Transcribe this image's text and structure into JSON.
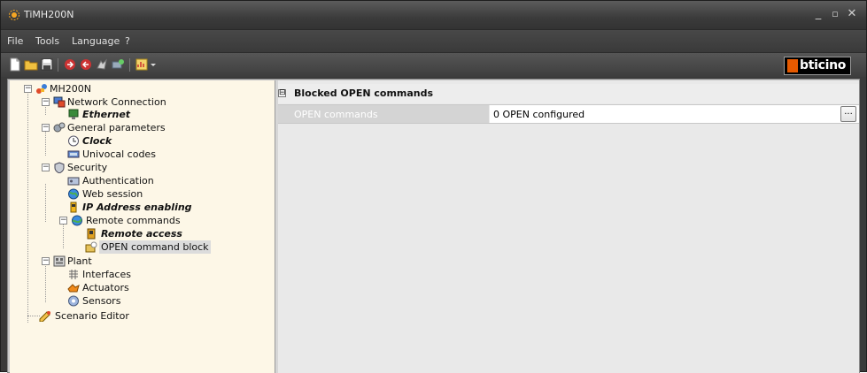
{
  "window": {
    "title": "TiMH200N",
    "minimize": "_",
    "maximize": "▫",
    "close": "✕"
  },
  "menu": [
    "File",
    "Tools",
    "Language",
    "?"
  ],
  "toolbar": {
    "buttons": [
      "new-file-icon",
      "open-folder-icon",
      "save-icon",
      "send-icon",
      "receive-icon",
      "device-icon",
      "network-icon",
      "report-icon",
      "dropdown-icon"
    ],
    "brand": "bticino"
  },
  "tree": {
    "root": "MH200N",
    "network_connection": "Network Connection",
    "ethernet": "Ethernet",
    "general_parameters": "General parameters",
    "clock": "Clock",
    "univocal_codes": "Univocal codes",
    "security": "Security",
    "authentication": "Authentication",
    "web_session": "Web session",
    "ip_address_enabling": "IP Address enabling",
    "remote_commands": "Remote commands",
    "remote_access": "Remote access",
    "open_command_block": "OPEN command block",
    "plant": "Plant",
    "interfaces": "Interfaces",
    "actuators": "Actuators",
    "sensors": "Sensors",
    "scenario_editor": "Scenario Editor"
  },
  "property_grid": {
    "section_title": "Blocked OPEN commands",
    "collapse_symbol": "⊟",
    "rows": [
      {
        "name": "OPEN commands",
        "value": "0 OPEN configured",
        "button": "..."
      }
    ]
  },
  "colors": {
    "tree_background": "#fdf7e7",
    "chrome_dark": "#3a3a3a",
    "brand_accent": "#e65a00"
  }
}
